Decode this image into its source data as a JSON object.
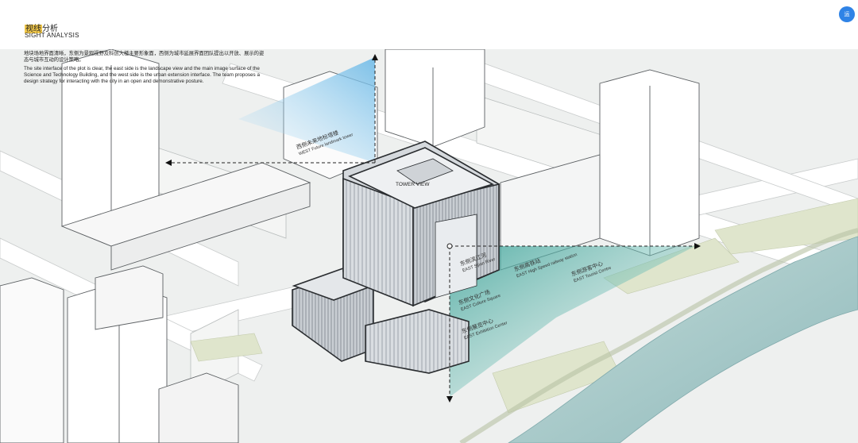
{
  "header": {
    "title_cn_highlight": "视线",
    "title_cn_rest": "分析",
    "title_en": "SIGHT ANALYSIS",
    "corner_button_icon": "chart-icon",
    "corner_button_label": "运"
  },
  "description": {
    "cn": "地块场地界面清晰，东侧为景观视野及科创大楼主要形象面，西侧为城市延展界面团队提出以开放、展示的姿态与城市互动的设计策略。",
    "en": "The site interface of the plot is clear, the east side is the landscape view and the main image surface of the Science and Technology Building, and the west side is the urban extension interface. The team proposes a design strategy for interacting with the city in an open and demonstrative posture."
  },
  "labels": {
    "tower_view": "TOWER VIEW",
    "west_cn": "西侧未来地标塔楼",
    "west_en": "WEST Future landmark tower",
    "east_river_cn": "东侧滨江河",
    "east_river_en": "EAST Sijian River",
    "east_station_cn": "东侧高铁站",
    "east_station_en": "EAST High Speed railway station",
    "east_tourist_cn": "东侧游客中心",
    "east_tourist_en": "EAST Tourist Centre",
    "east_exhibit_cn": "东侧展览中心",
    "east_exhibit_en": "EAST Exhibition Center",
    "east_culture_cn": "东侧文化广场",
    "east_culture_en": "EAST Culture Square"
  },
  "colors": {
    "highlight": "#f3c94a",
    "sight_west": "#8cc9ee",
    "sight_east": "#5fb8ae",
    "river": "#9fc7c6",
    "park": "#dfe5cc",
    "button": "#2f83e6"
  }
}
